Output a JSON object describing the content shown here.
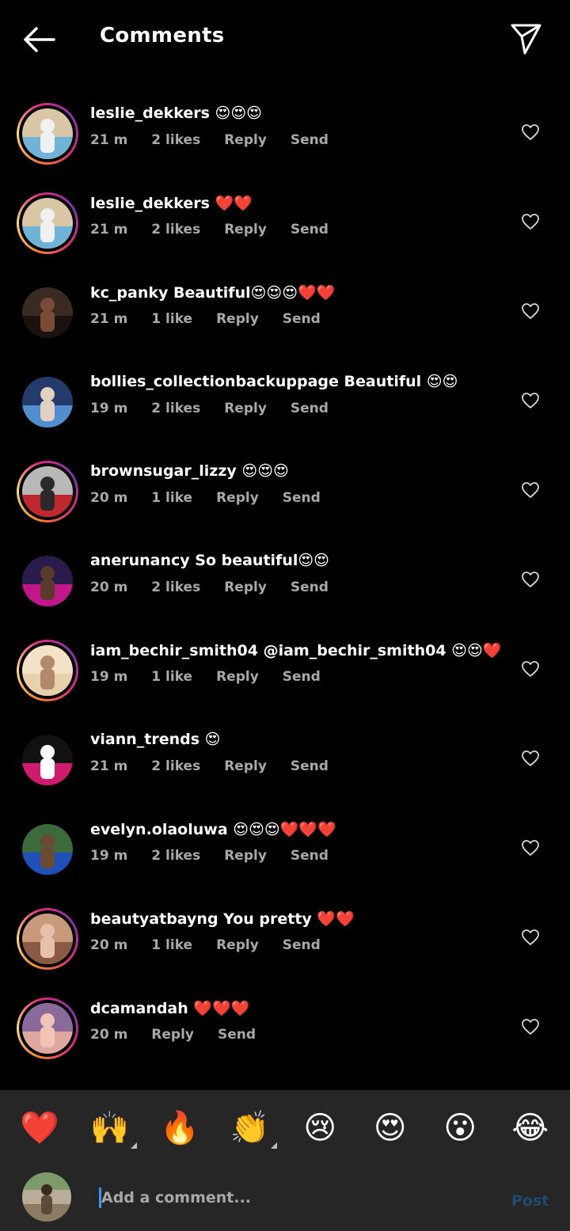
{
  "header": {
    "title": "Comments"
  },
  "comments": [
    {
      "username": "leslie_dekkers",
      "text": " 😍😍😍",
      "time": "21 m",
      "likes": "2 likes",
      "reply": "Reply",
      "send": "Send",
      "story": true,
      "avatar": {
        "bg1": "#d9c6a5",
        "bg2": "#6fb3d9",
        "fig": "#f0f0f0"
      }
    },
    {
      "username": "leslie_dekkers",
      "text": " ❤️❤️",
      "time": "21 m",
      "likes": "2 likes",
      "reply": "Reply",
      "send": "Send",
      "story": true,
      "avatar": {
        "bg1": "#d9c6a5",
        "bg2": "#6fb3d9",
        "fig": "#f0f0f0"
      }
    },
    {
      "username": "kc_panky",
      "text": " Beautiful😍😍😍❤️❤️",
      "time": "21 m",
      "likes": "1 like",
      "reply": "Reply",
      "send": "Send",
      "story": false,
      "avatar": {
        "bg1": "#3a2a22",
        "bg2": "#1a1210",
        "fig": "#7a4b35"
      }
    },
    {
      "username": "bollies_collectionbackuppage",
      "text": " Beautiful 😍😍",
      "time": "19 m",
      "likes": "2 likes",
      "reply": "Reply",
      "send": "Send",
      "story": false,
      "avatar": {
        "bg1": "#233a6b",
        "bg2": "#4f8fd0",
        "fig": "#e3d0c0"
      }
    },
    {
      "username": "brownsugar_lizzy",
      "text": " 😍😍😍",
      "time": "20 m",
      "likes": "1 like",
      "reply": "Reply",
      "send": "Send",
      "story": true,
      "avatar": {
        "bg1": "#b8b8b8",
        "bg2": "#c0282d",
        "fig": "#2a2a2a"
      }
    },
    {
      "username": "anerunancy",
      "text": " So beautiful😍😍",
      "time": "20 m",
      "likes": "2 likes",
      "reply": "Reply",
      "send": "Send",
      "story": false,
      "avatar": {
        "bg1": "#2a1c4a",
        "bg2": "#c2168a",
        "fig": "#5a3a2a"
      }
    },
    {
      "username": "iam_bechir_smith04",
      "text": " @iam_bechir_smith04 😍😍❤️",
      "time": "19 m",
      "likes": "1 like",
      "reply": "Reply",
      "send": "Send",
      "story": true,
      "avatar": {
        "bg1": "#f3e2c6",
        "bg2": "#e8d0aa",
        "fig": "#b08a6a"
      }
    },
    {
      "username": "viann_trends",
      "text": " 😍",
      "time": "21 m",
      "likes": "2 likes",
      "reply": "Reply",
      "send": "Send",
      "story": false,
      "avatar": {
        "bg1": "#111111",
        "bg2": "#d01a6e",
        "fig": "#ffffff"
      }
    },
    {
      "username": "evelyn.olaoluwa",
      "text": " 😍😍😍❤️❤️❤️",
      "time": "19 m",
      "likes": "2 likes",
      "reply": "Reply",
      "send": "Send",
      "story": false,
      "avatar": {
        "bg1": "#3c6a3a",
        "bg2": "#1f4fb8",
        "fig": "#6a4a30"
      }
    },
    {
      "username": "beautyatbayng",
      "text": " You pretty ❤️❤️",
      "time": "20 m",
      "likes": "1 like",
      "reply": "Reply",
      "send": "Send",
      "story": true,
      "avatar": {
        "bg1": "#c89a7a",
        "bg2": "#8a5a44",
        "fig": "#e6c0a8"
      }
    },
    {
      "username": "dcamandah",
      "text": " ❤️❤️❤️",
      "time": "20 m",
      "likes": "",
      "reply": "Reply",
      "send": "Send",
      "story": true,
      "avatar": {
        "bg1": "#8a6a9a",
        "bg2": "#e0a6a0",
        "fig": "#f1c4b6"
      }
    }
  ],
  "emoji_bar": [
    {
      "char": "❤️",
      "name": "red-heart-emoji",
      "corner": false
    },
    {
      "char": "🙌",
      "name": "raising-hands-emoji",
      "corner": true
    },
    {
      "char": "🔥",
      "name": "fire-emoji",
      "corner": false
    },
    {
      "char": "👏",
      "name": "clapping-hands-emoji",
      "corner": true
    },
    {
      "char": "😢",
      "name": "crying-face-emoji",
      "corner": false
    },
    {
      "char": "😍",
      "name": "heart-eyes-emoji",
      "corner": false
    },
    {
      "char": "😮",
      "name": "surprised-face-emoji",
      "corner": false
    },
    {
      "char": "😂",
      "name": "tears-of-joy-emoji",
      "corner": false
    }
  ],
  "composer": {
    "placeholder": "Add a comment...",
    "post_label": "Post"
  },
  "colors": {
    "background": "#000000",
    "meta": "#a8a8a8",
    "bar": "#262626",
    "post": "#1f4a73"
  }
}
